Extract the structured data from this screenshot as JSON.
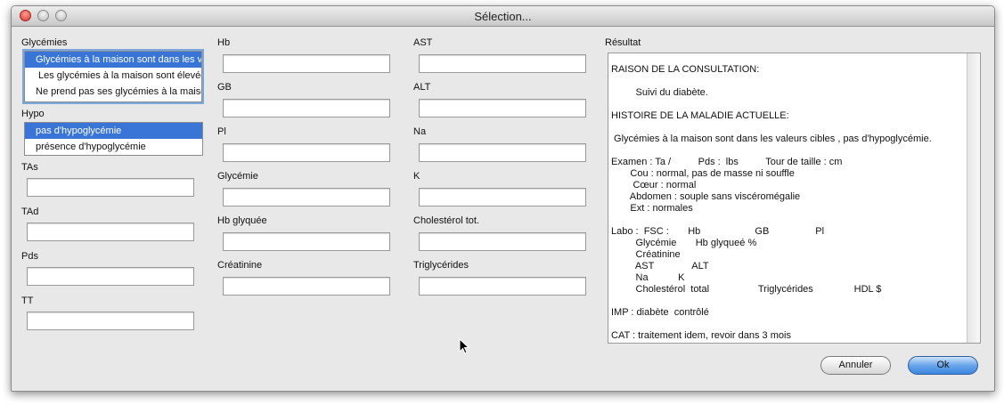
{
  "window": {
    "title": "Sélection..."
  },
  "glycemies": {
    "label": "Glycémies",
    "items": [
      "Glycémies à la maison sont dans les valeurs cibles",
      "Les glycémies  à la maison sont élevées",
      "Ne prend pas ses glycémies à la maison"
    ]
  },
  "hypo": {
    "label": "Hypo",
    "items": [
      "pas d'hypoglycémie",
      "présence d'hypoglycémie"
    ]
  },
  "fields": {
    "tas": {
      "label": "TAs",
      "value": ""
    },
    "tad": {
      "label": "TAd",
      "value": ""
    },
    "pds": {
      "label": "Pds",
      "value": ""
    },
    "tt": {
      "label": "TT",
      "value": ""
    },
    "hb": {
      "label": "Hb",
      "value": ""
    },
    "gb": {
      "label": "GB",
      "value": ""
    },
    "pl": {
      "label": "Pl",
      "value": ""
    },
    "glycemie": {
      "label": "Glycémie",
      "value": ""
    },
    "hb_glyquee": {
      "label": "Hb glyquée",
      "value": ""
    },
    "creatinine": {
      "label": "Créatinine",
      "value": ""
    },
    "ast": {
      "label": "AST",
      "value": ""
    },
    "alt": {
      "label": "ALT",
      "value": ""
    },
    "na": {
      "label": "Na",
      "value": ""
    },
    "k": {
      "label": "K",
      "value": ""
    },
    "cholesterol": {
      "label": "Cholestérol tot.",
      "value": ""
    },
    "triglycerides": {
      "label": "Triglycérides",
      "value": ""
    }
  },
  "result": {
    "label": "Résultat",
    "text": "RAISON DE LA CONSULTATION:\n\n         Suivi du diabète.\n\nHISTOIRE DE LA MALADIE ACTUELLE:\n\n Glycémies à la maison sont dans les valeurs cibles , pas d'hypoglycémie.\n\nExamen : Ta /          Pds :  lbs          Tour de taille : cm\n       Cou : normal, pas de masse ni souffle\n        Cœur : normal\n       Abdomen : souple sans viscéromégalie\n       Ext : normales\n\nLabo :  FSC :       Hb                    GB                 Pl\n         Glycémie       Hb glyqueé %\n         Créatinine\n         AST              ALT\n         Na           K\n         Cholestérol  total                  Triglycérides               HDL $\n\nIMP : diabète  contrôlé\n\nCAT : traitement idem, revoir dans 3 mois"
  },
  "buttons": {
    "cancel": "Annuler",
    "ok": "Ok"
  }
}
